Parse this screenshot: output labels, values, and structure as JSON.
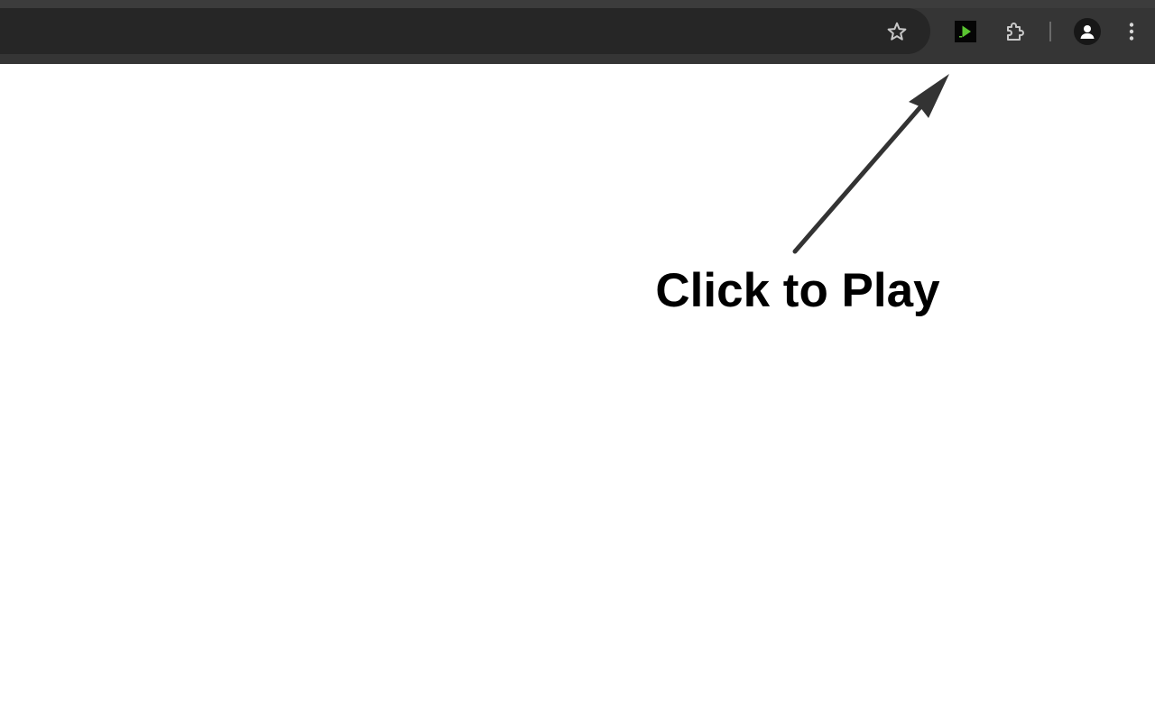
{
  "browser": {
    "toolbar_color": "#353535",
    "omnibox_color": "#262626",
    "icons": {
      "bookmark": "star-outline-icon",
      "extension_play": "green-play-icon",
      "extensions": "puzzle-piece-icon",
      "profile": "person-icon",
      "menu": "three-dots-vertical-icon"
    },
    "accent_color": "#5ac531"
  },
  "content": {
    "call_to_action": "Click to Play"
  }
}
